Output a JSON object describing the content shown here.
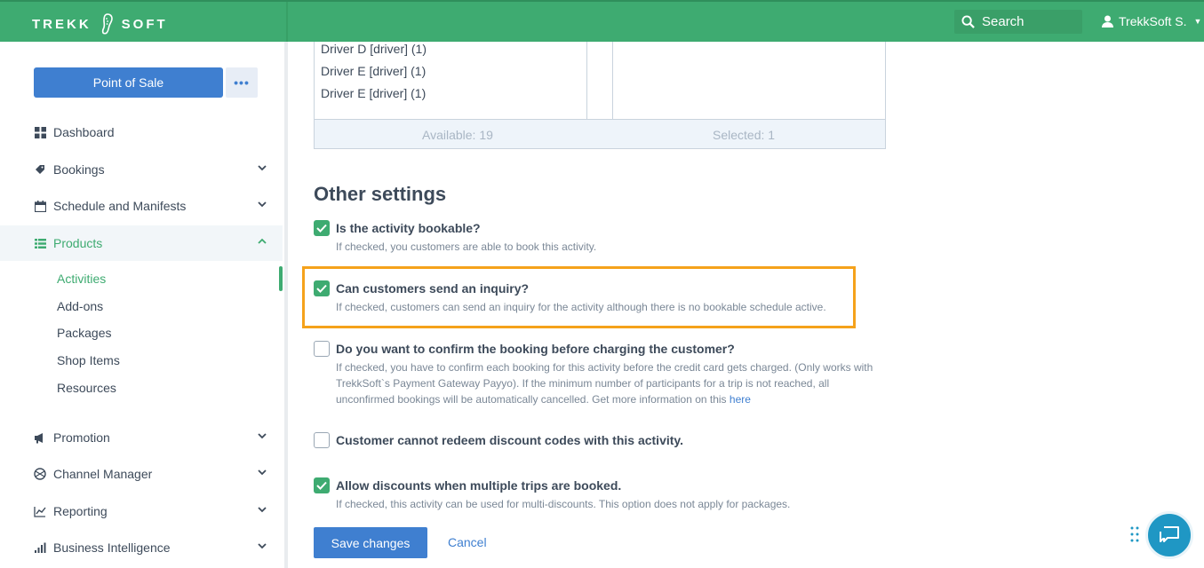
{
  "brand": {
    "left": "TREKK",
    "right": "SOFT",
    "logo_icon": "shoe-icon"
  },
  "header": {
    "search_label": "Search",
    "user_name": "TrekkSoft S.",
    "user_icon": "user-icon",
    "accent": "#3eab71"
  },
  "sidebar": {
    "pos_button": "Point of Sale",
    "more_button": "•••",
    "items": [
      {
        "label": "Dashboard",
        "icon": "dashboard-icon"
      },
      {
        "label": "Bookings",
        "icon": "tag-icon"
      },
      {
        "label": "Schedule and Manifests",
        "icon": "calendar-icon"
      },
      {
        "label": "Products",
        "icon": "list-icon"
      },
      {
        "label": "Promotion",
        "icon": "megaphone-icon"
      },
      {
        "label": "Channel Manager",
        "icon": "globe-icon"
      },
      {
        "label": "Reporting",
        "icon": "line-chart-icon"
      },
      {
        "label": "Business Intelligence",
        "icon": "bar-chart-icon"
      }
    ],
    "products_sub": [
      "Activities",
      "Add-ons",
      "Packages",
      "Shop Items",
      "Resources"
    ]
  },
  "resources_list": {
    "drivers": [
      "Driver D [driver] (1)",
      "Driver E [driver] (1)",
      "Driver E [driver] (1)"
    ],
    "available": "Available: 19",
    "selected": "Selected: 1"
  },
  "settings": {
    "title": "Other settings",
    "options": [
      {
        "label": "Is the activity bookable?",
        "checked": true,
        "help": [
          "If checked, you customers are able to book this activity."
        ]
      },
      {
        "label": "Can customers send an inquiry?",
        "checked": true,
        "help": [
          "If checked, customers can send an inquiry for the activity although there is no bookable schedule active."
        ]
      },
      {
        "label": "Do you want to confirm the booking before charging the customer?",
        "checked": false,
        "help": [
          "If checked, you have to confirm each booking for this activity before the credit card gets charged. (Only works with",
          "TrekkSoft`s Payment Gateway Payyo). If the minimum number of participants for a trip is not reached, all",
          "unconfirmed bookings will be automatically cancelled. Get more information on this"
        ],
        "link": "here"
      },
      {
        "label": "Customer cannot redeem discount codes with this activity.",
        "checked": false,
        "help": []
      },
      {
        "label": "Allow discounts when multiple trips are booked.",
        "checked": true,
        "help": [
          "If checked, this activity can be used for multi-discounts. This option does not apply for packages."
        ]
      }
    ]
  },
  "actions": {
    "save": "Save changes",
    "cancel": "Cancel"
  },
  "chat": {
    "icon": "chat-icon"
  }
}
